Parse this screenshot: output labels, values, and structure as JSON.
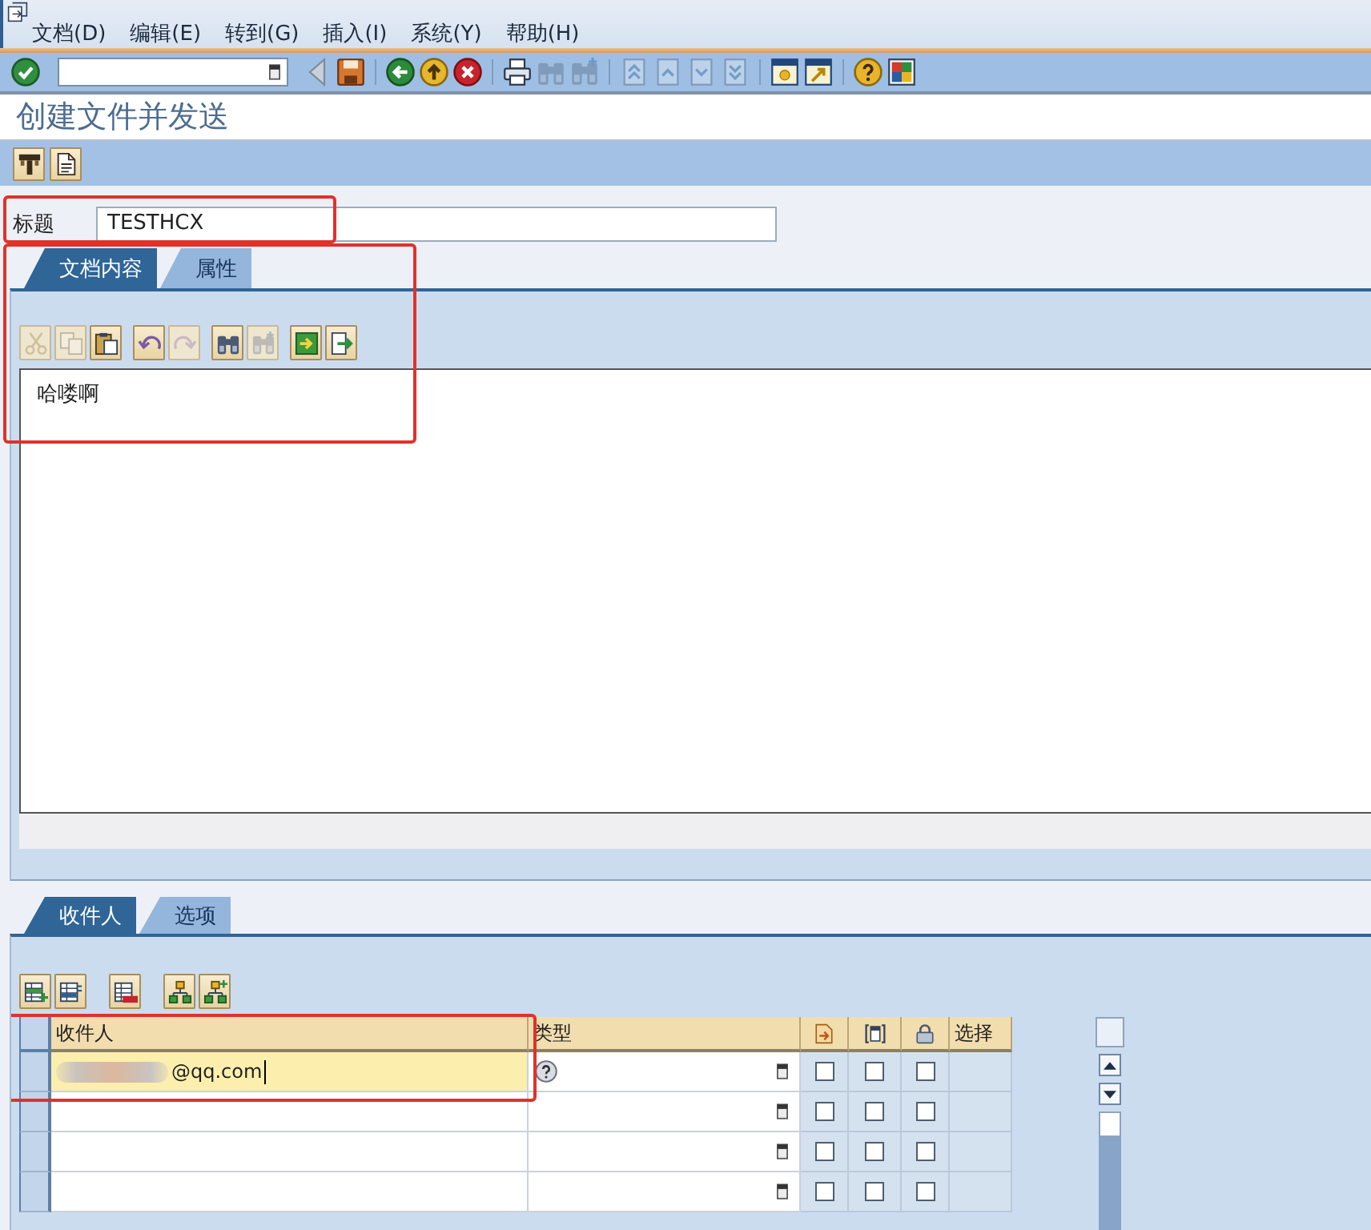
{
  "menu_bar": {
    "items": [
      "文档(D)",
      "编辑(E)",
      "转到(G)",
      "插入(I)",
      "系统(Y)",
      "帮助(H)"
    ]
  },
  "standard_toolbar": {
    "groups": [
      [
        {
          "kind": "enter",
          "disabled": false
        }
      ],
      [
        {
          "kind": "history",
          "disabled": false
        },
        {
          "kind": "save",
          "disabled": false
        }
      ],
      [
        {
          "kind": "back",
          "disabled": false
        },
        {
          "kind": "exit",
          "disabled": false
        },
        {
          "kind": "cancel",
          "disabled": false
        }
      ],
      [
        {
          "kind": "print",
          "disabled": false
        },
        {
          "kind": "find",
          "disabled": true
        },
        {
          "kind": "find-next",
          "disabled": true
        }
      ],
      [
        {
          "kind": "first-page",
          "disabled": true
        },
        {
          "kind": "prev-page",
          "disabled": true
        },
        {
          "kind": "next-page",
          "disabled": true
        },
        {
          "kind": "last-page",
          "disabled": true
        }
      ],
      [
        {
          "kind": "new-session",
          "disabled": false
        },
        {
          "kind": "shortcut",
          "disabled": false
        }
      ],
      [
        {
          "kind": "help",
          "disabled": false
        },
        {
          "kind": "layout",
          "disabled": false
        }
      ]
    ]
  },
  "screen_title": "创建文件并发送",
  "application_toolbar": {
    "buttons": [
      {
        "kind": "title-block"
      },
      {
        "kind": "attributes"
      }
    ]
  },
  "subject": {
    "label": "标题",
    "value": "TESTHCX",
    "highlighted": true
  },
  "document": {
    "highlighted": true,
    "tabs": [
      {
        "label": "文档内容",
        "selected": true
      },
      {
        "label": "属性",
        "selected": false
      }
    ],
    "toolbar": {
      "groups": [
        [
          {
            "kind": "cut",
            "disabled": true
          },
          {
            "kind": "copy",
            "disabled": true
          },
          {
            "kind": "paste",
            "disabled": false
          }
        ],
        [
          {
            "kind": "undo",
            "disabled": false
          },
          {
            "kind": "redo",
            "disabled": true
          }
        ],
        [
          {
            "kind": "find",
            "disabled": false
          },
          {
            "kind": "find-next",
            "disabled": true
          }
        ],
        [
          {
            "kind": "import",
            "disabled": false
          },
          {
            "kind": "export",
            "disabled": false
          }
        ]
      ]
    },
    "text": "哈喽啊"
  },
  "recipients": {
    "tabs": [
      {
        "label": "收件人",
        "selected": true
      },
      {
        "label": "选项",
        "selected": false
      }
    ],
    "toolbar": {
      "groups": [
        [
          {
            "kind": "insert-row"
          },
          {
            "kind": "select-rows"
          }
        ],
        [
          {
            "kind": "delete-row"
          }
        ],
        [
          {
            "kind": "distribution-list"
          },
          {
            "kind": "distribution-add"
          }
        ]
      ]
    },
    "table": {
      "columns": [
        {
          "kind": "input",
          "label": "收件人",
          "highlighted": true
        },
        {
          "kind": "listbox",
          "label": "类型",
          "highlighted": false
        },
        {
          "kind": "express",
          "highlighted": false
        },
        {
          "kind": "copy",
          "highlighted": false
        },
        {
          "kind": "blind",
          "highlighted": false
        },
        {
          "kind": "select",
          "label": "选择",
          "highlighted": false
        }
      ],
      "rows": [
        {
          "recipient": "@qq.com",
          "redacted": true,
          "focused": true,
          "checks": [
            {
              "checked": false
            },
            {
              "checked": false
            },
            {
              "checked": false
            }
          ]
        },
        {
          "redacted": false,
          "focused": false,
          "checks": [
            {
              "checked": false
            },
            {
              "checked": false
            },
            {
              "checked": false
            }
          ]
        },
        {
          "redacted": false,
          "focused": false,
          "checks": [
            {
              "checked": false
            },
            {
              "checked": false
            },
            {
              "checked": false
            }
          ]
        },
        {
          "redacted": false,
          "focused": false,
          "checks": [
            {
              "checked": false
            },
            {
              "checked": false
            },
            {
              "checked": false
            }
          ]
        }
      ]
    }
  }
}
